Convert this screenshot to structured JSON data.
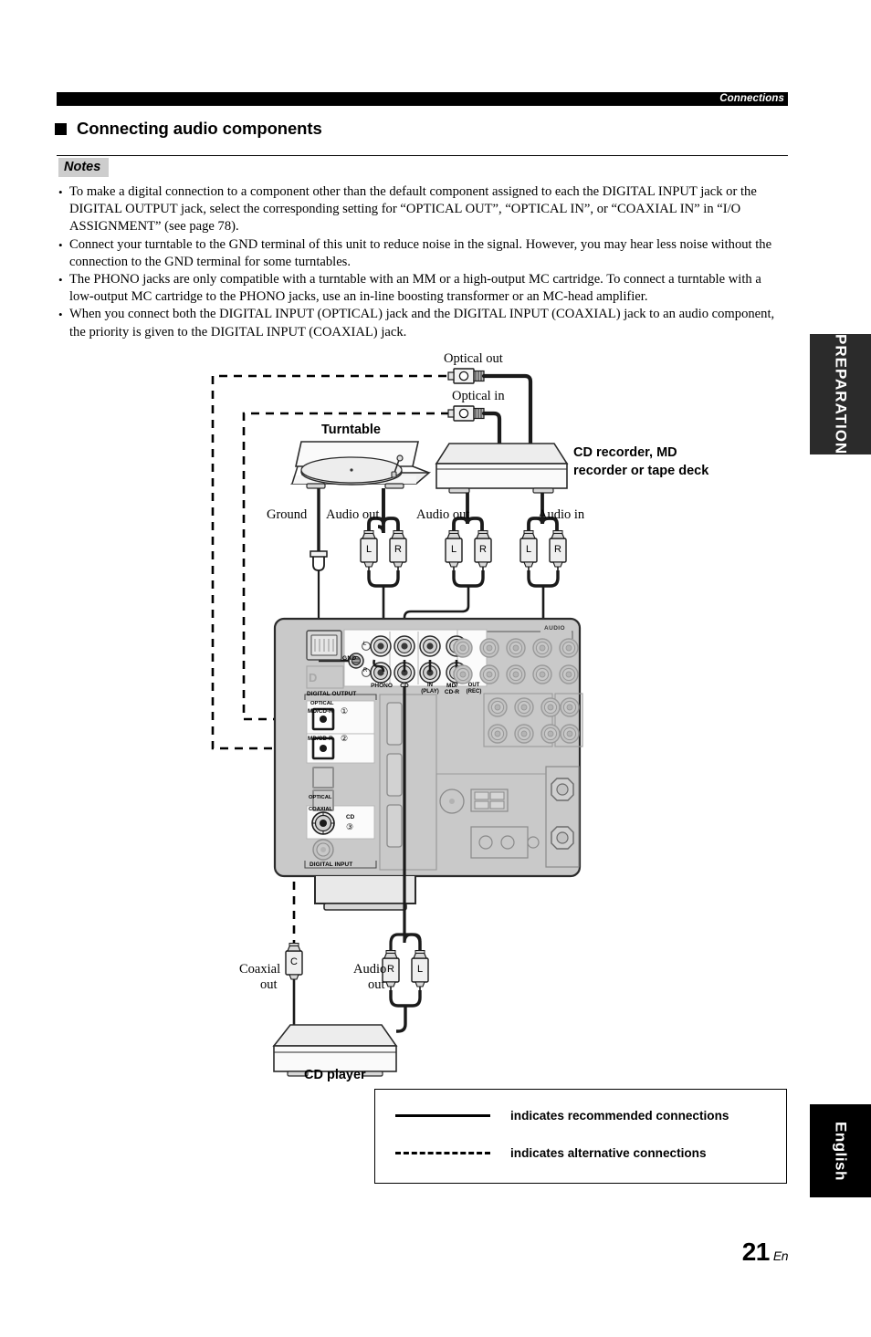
{
  "header": {
    "chapter": "Connections"
  },
  "section": {
    "title": "Connecting audio components",
    "bullet_icon": "filled-square-icon"
  },
  "notes": {
    "label": "Notes",
    "items": [
      "To make a digital connection to a component other than the default component assigned to each the DIGITAL INPUT jack or the DIGITAL OUTPUT jack, select the corresponding setting for “OPTICAL OUT”, “OPTICAL IN”, or “COAXIAL IN” in “I/O ASSIGNMENT” (see page 78).",
      "Connect your turntable to the GND terminal of this unit to reduce noise in the signal. However, you may hear less noise without the connection to the GND terminal for some turntables.",
      "The PHONO jacks are only compatible with a turntable with an MM or a high-output MC cartridge. To connect a turntable with a low-output MC cartridge to the PHONO jacks, use an in-line boosting transformer or an MC-head amplifier.",
      "When you connect both the DIGITAL INPUT (OPTICAL) jack and the DIGITAL INPUT (COAXIAL) jack to an audio component, the priority is given to the DIGITAL INPUT (COAXIAL) jack."
    ]
  },
  "diagram": {
    "optical_out_label": "Optical out",
    "optical_in_label": "Optical in",
    "turntable_label": "Turntable",
    "recorder_label_line1": "CD recorder, MD",
    "recorder_label_line2": "recorder or tape deck",
    "ground_label": "Ground",
    "audio_out_turntable": "Audio out",
    "audio_out_recorder": "Audio out",
    "audio_in_recorder": "Audio in",
    "coaxial_out_line1": "Coaxial",
    "coaxial_out_line2": "out",
    "audio_out_cd_line1": "Audio",
    "audio_out_cd_line2": "out",
    "cd_player_label": "CD player",
    "plugs": {
      "left": "L",
      "right": "R",
      "coax": "C"
    },
    "rear_panel": {
      "audio_group": "AUDIO",
      "gnd": "GND",
      "channel_l": "L",
      "channel_r": "R",
      "phono": "PHONO",
      "cd": "CD",
      "md_cdr_line1": "MD/",
      "md_cdr_line2": "CD-R",
      "in_play_line1": "IN",
      "in_play_line2": "(PLAY)",
      "out_rec_line1": "OUT",
      "out_rec_line2": "(REC)",
      "digital_output": "DIGITAL OUTPUT",
      "digital_input": "DIGITAL INPUT",
      "optical": "OPTICAL",
      "coaxial": "COAXIAL",
      "md_cdr_opt1": "MD/CD-R",
      "md_cdr_opt1_num": "①",
      "md_cdr_opt2": "MD/CD-R",
      "md_cdr_opt2_num": "②",
      "cd_coax": "CD",
      "cd_coax_num": "③",
      "d_mark": "D"
    }
  },
  "legend": {
    "recommended": "indicates recommended connections",
    "alternative": "indicates alternative connections"
  },
  "footer": {
    "page_number": "21",
    "page_suffix": "En"
  },
  "side_tabs": {
    "preparation": "PREPARATION",
    "english": "English"
  },
  "colors": {
    "header_bar": "#000000",
    "notes_label_bg": "#cdcdcd",
    "panel_body": "#c9c9c9",
    "panel_light": "#e0e0e0",
    "device_top": "#e8e8e8",
    "device_front": "#f4f4f4",
    "tab_preparation": "#2b2b2b",
    "tab_english": "#000000"
  }
}
